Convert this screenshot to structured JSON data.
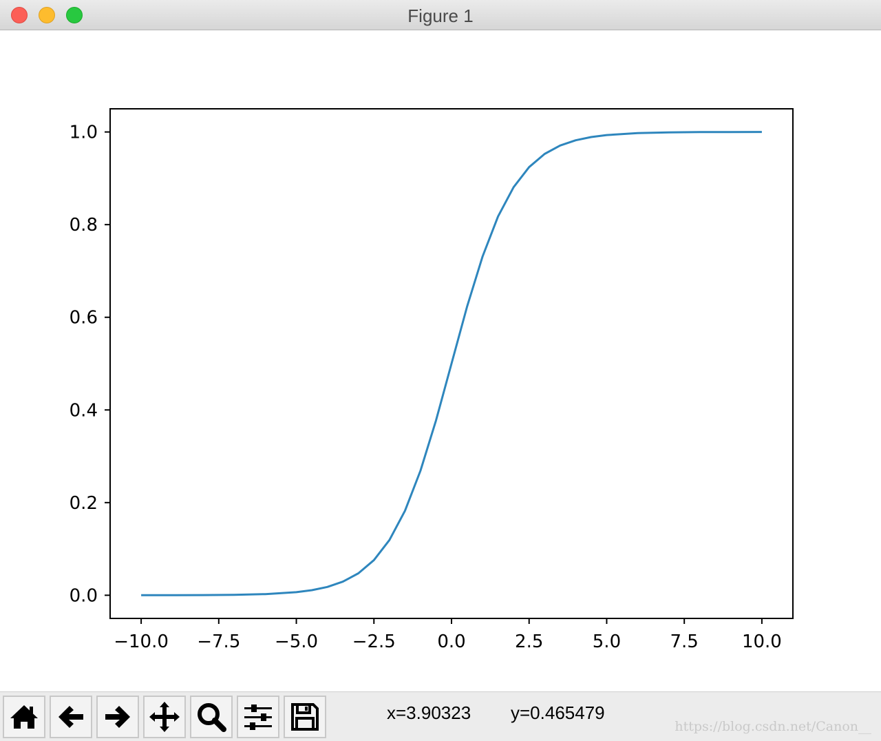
{
  "window": {
    "title": "Figure 1",
    "buttons": [
      "close",
      "minimize",
      "zoom"
    ]
  },
  "toolbar": {
    "buttons": [
      {
        "name": "home",
        "icon": "home-icon"
      },
      {
        "name": "back",
        "icon": "arrow-left-icon"
      },
      {
        "name": "forward",
        "icon": "arrow-right-icon"
      },
      {
        "name": "pan",
        "icon": "move-icon"
      },
      {
        "name": "zoom",
        "icon": "magnifier-icon"
      },
      {
        "name": "configure-subplots",
        "icon": "sliders-icon"
      },
      {
        "name": "save",
        "icon": "floppy-disk-icon"
      }
    ],
    "x_readout": "x=3.90323",
    "y_readout": "y=0.465479"
  },
  "watermark": "https://blog.csdn.net/Canon__",
  "colors": {
    "line": "#2e86bd",
    "axes": "#000000",
    "titlebar": "#e0e0e0",
    "toolbar": "#ececec"
  },
  "chart_data": {
    "type": "line",
    "title": "",
    "xlabel": "",
    "ylabel": "",
    "xlim": [
      -11.0,
      11.0
    ],
    "ylim": [
      -0.05,
      1.05
    ],
    "xticks": [
      -10.0,
      -7.5,
      -5.0,
      -2.5,
      0.0,
      2.5,
      5.0,
      7.5,
      10.0
    ],
    "xtick_labels": [
      "−10.0",
      "−7.5",
      "−5.0",
      "−2.5",
      "0.0",
      "2.5",
      "5.0",
      "7.5",
      "10.0"
    ],
    "yticks": [
      0.0,
      0.2,
      0.4,
      0.6,
      0.8,
      1.0
    ],
    "ytick_labels": [
      "0.0",
      "0.2",
      "0.4",
      "0.6",
      "0.8",
      "1.0"
    ],
    "grid": false,
    "series": [
      {
        "x": [
          -10,
          -9,
          -8,
          -7,
          -6,
          -5,
          -4.5,
          -4,
          -3.5,
          -3,
          -2.5,
          -2,
          -1.5,
          -1,
          -0.5,
          0,
          0.5,
          1,
          1.5,
          2,
          2.5,
          3,
          3.5,
          4,
          4.5,
          5,
          6,
          7,
          8,
          9,
          10
        ],
        "y": [
          4.54e-05,
          0.0001234,
          0.0003354,
          0.000911,
          0.002473,
          0.006693,
          0.01099,
          0.01799,
          0.02931,
          0.04743,
          0.07586,
          0.1192,
          0.1824,
          0.2689,
          0.3775,
          0.5,
          0.6225,
          0.7311,
          0.8176,
          0.8808,
          0.9241,
          0.9526,
          0.9707,
          0.982,
          0.989,
          0.9933,
          0.9975,
          0.9991,
          0.9997,
          0.9999,
          1.0
        ]
      }
    ]
  }
}
